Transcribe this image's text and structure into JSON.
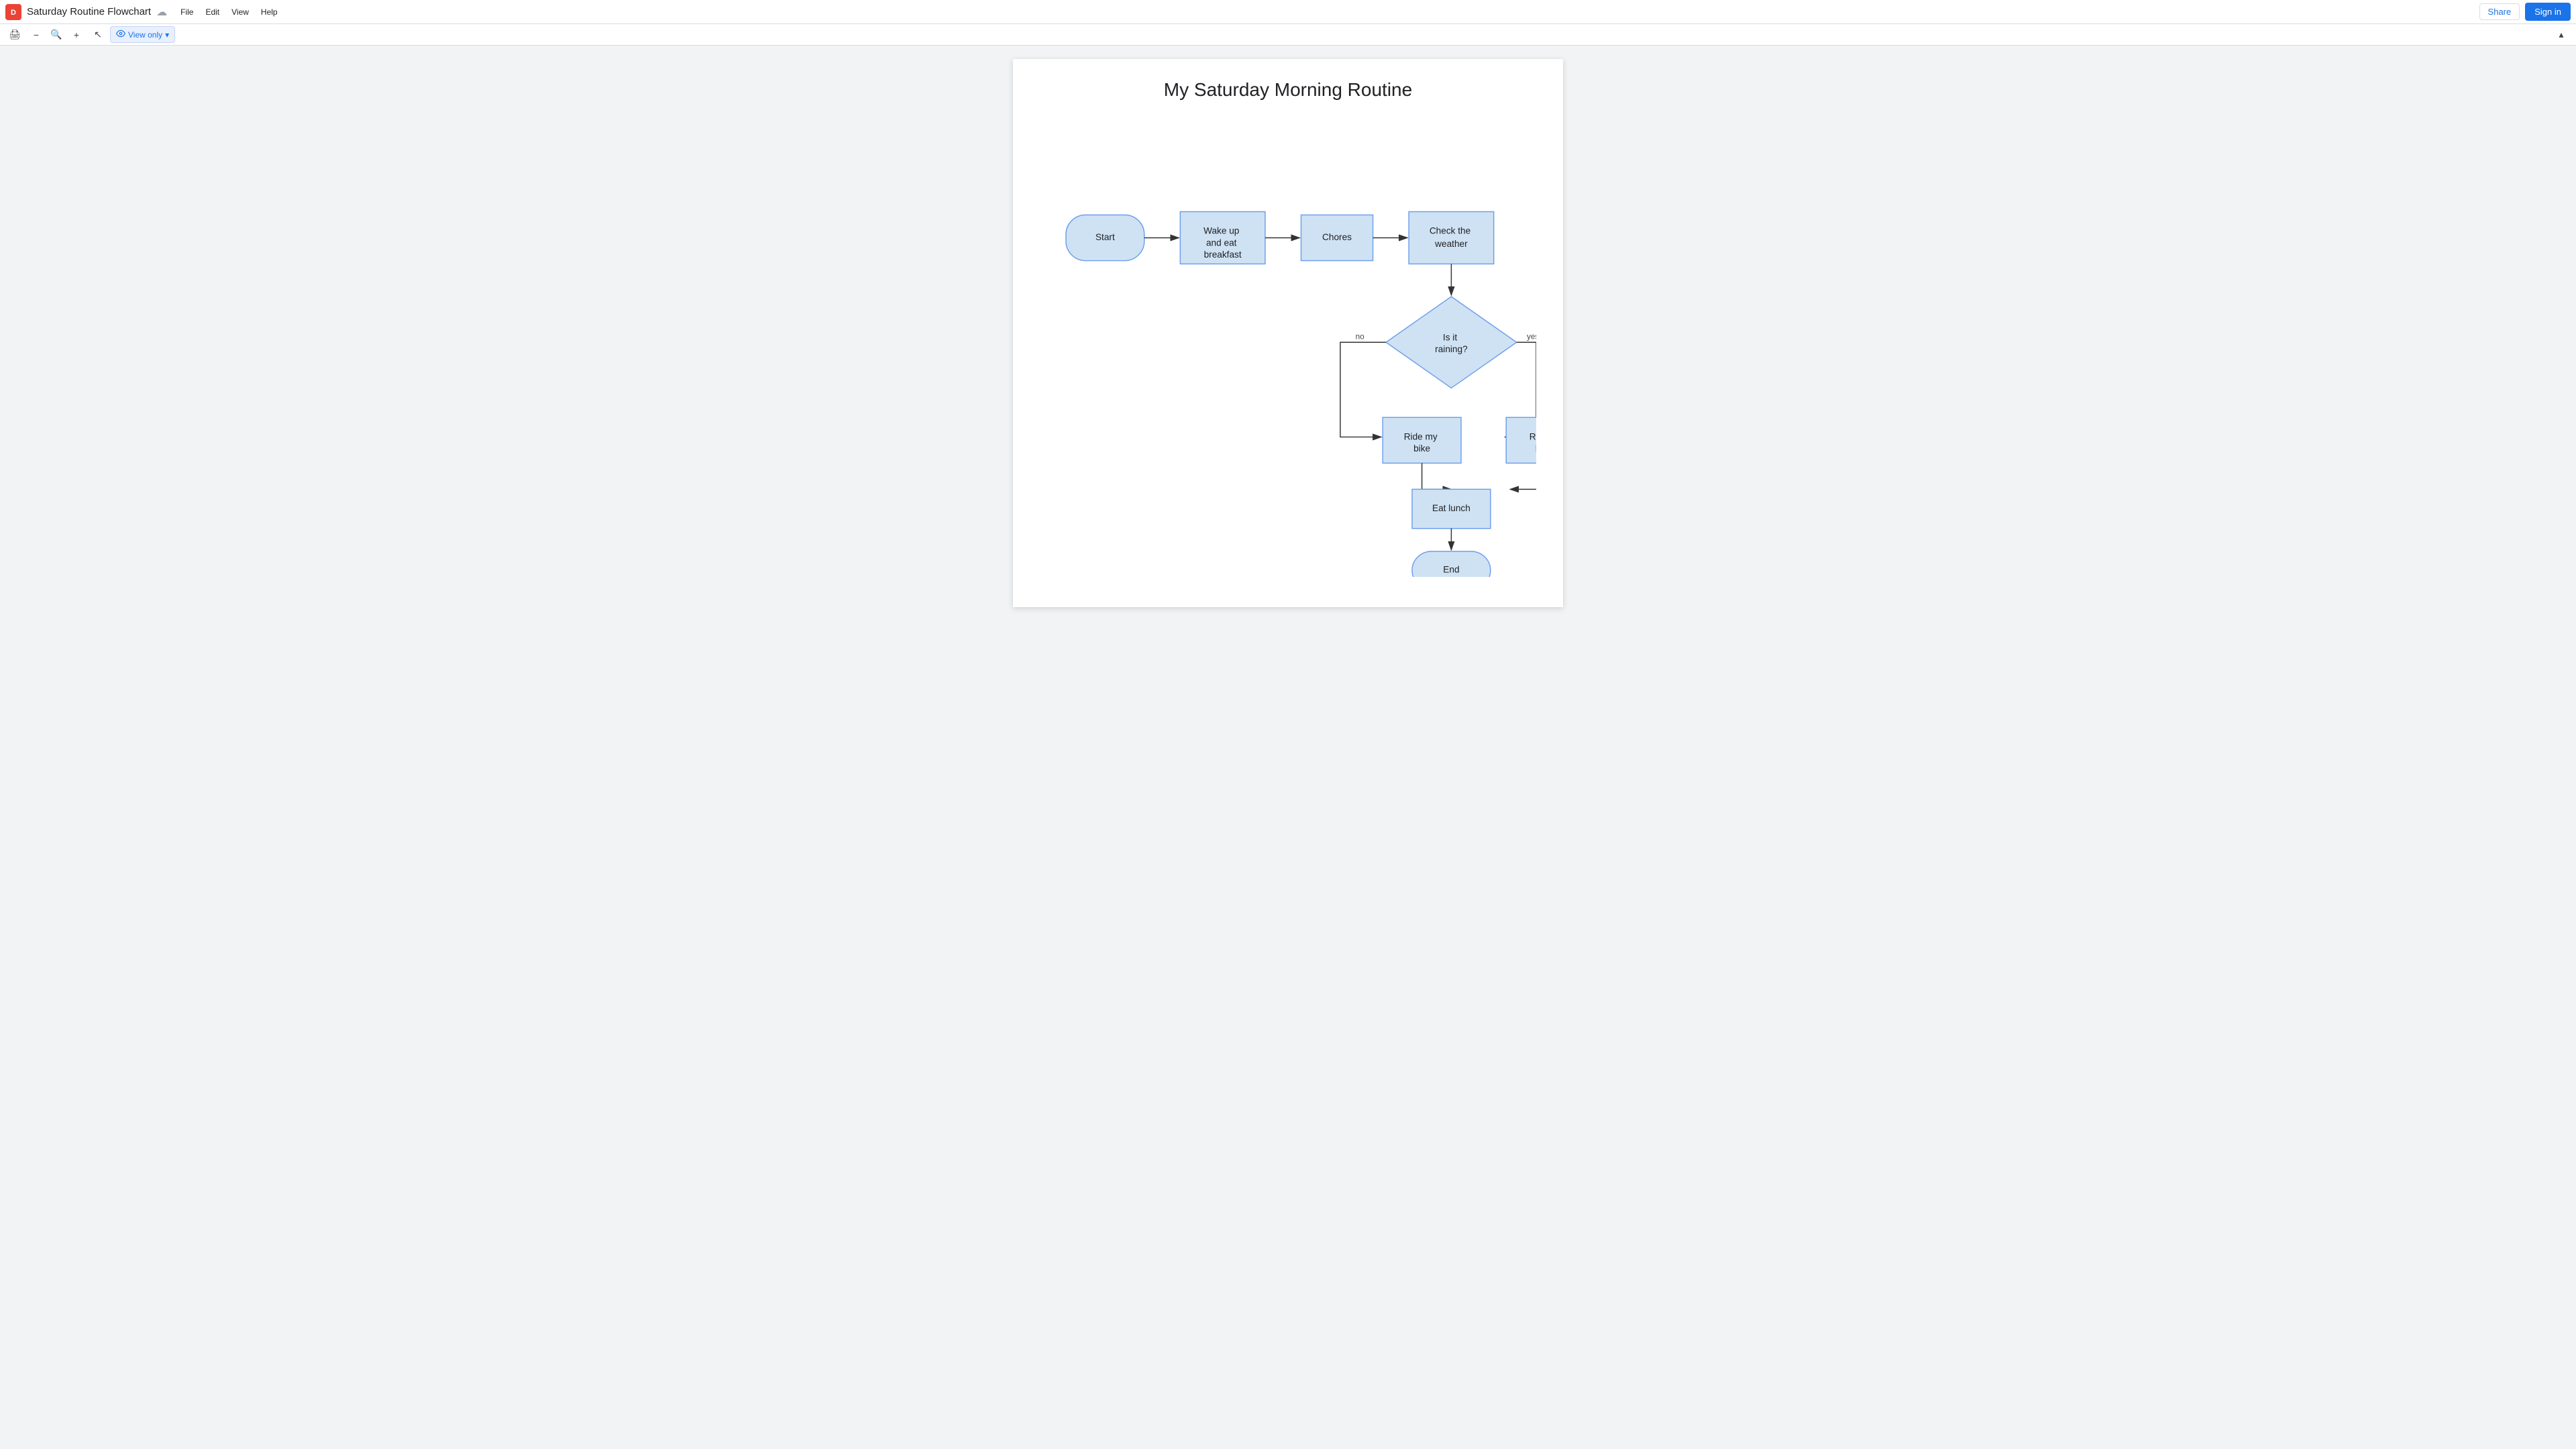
{
  "topbar": {
    "app_icon_label": "D",
    "doc_title": "Saturday Routine Flowchart",
    "menu_items": [
      "File",
      "Edit",
      "View",
      "Help"
    ],
    "share_label": "Share",
    "signin_label": "Sign in"
  },
  "toolbar": {
    "print_icon": "🖨",
    "zoom_in_icon": "+",
    "zoom_out_icon": "−",
    "cursor_icon": "↖",
    "view_only_label": "View only",
    "view_only_icon": "👁",
    "chevron_icon": "▾",
    "collapse_icon": "▴"
  },
  "document": {
    "title": "My Saturday Morning Routine",
    "nodes": {
      "start": "Start",
      "wake_up": "Wake up and eat breakfast",
      "chores": "Chores",
      "check_weather": "Check the weather",
      "is_raining": "Is it raining?",
      "ride_bike": "Ride my bike",
      "read_book": "Read a book",
      "eat_lunch": "Eat lunch",
      "end": "End"
    },
    "labels": {
      "no": "no",
      "yes": "yes"
    }
  }
}
